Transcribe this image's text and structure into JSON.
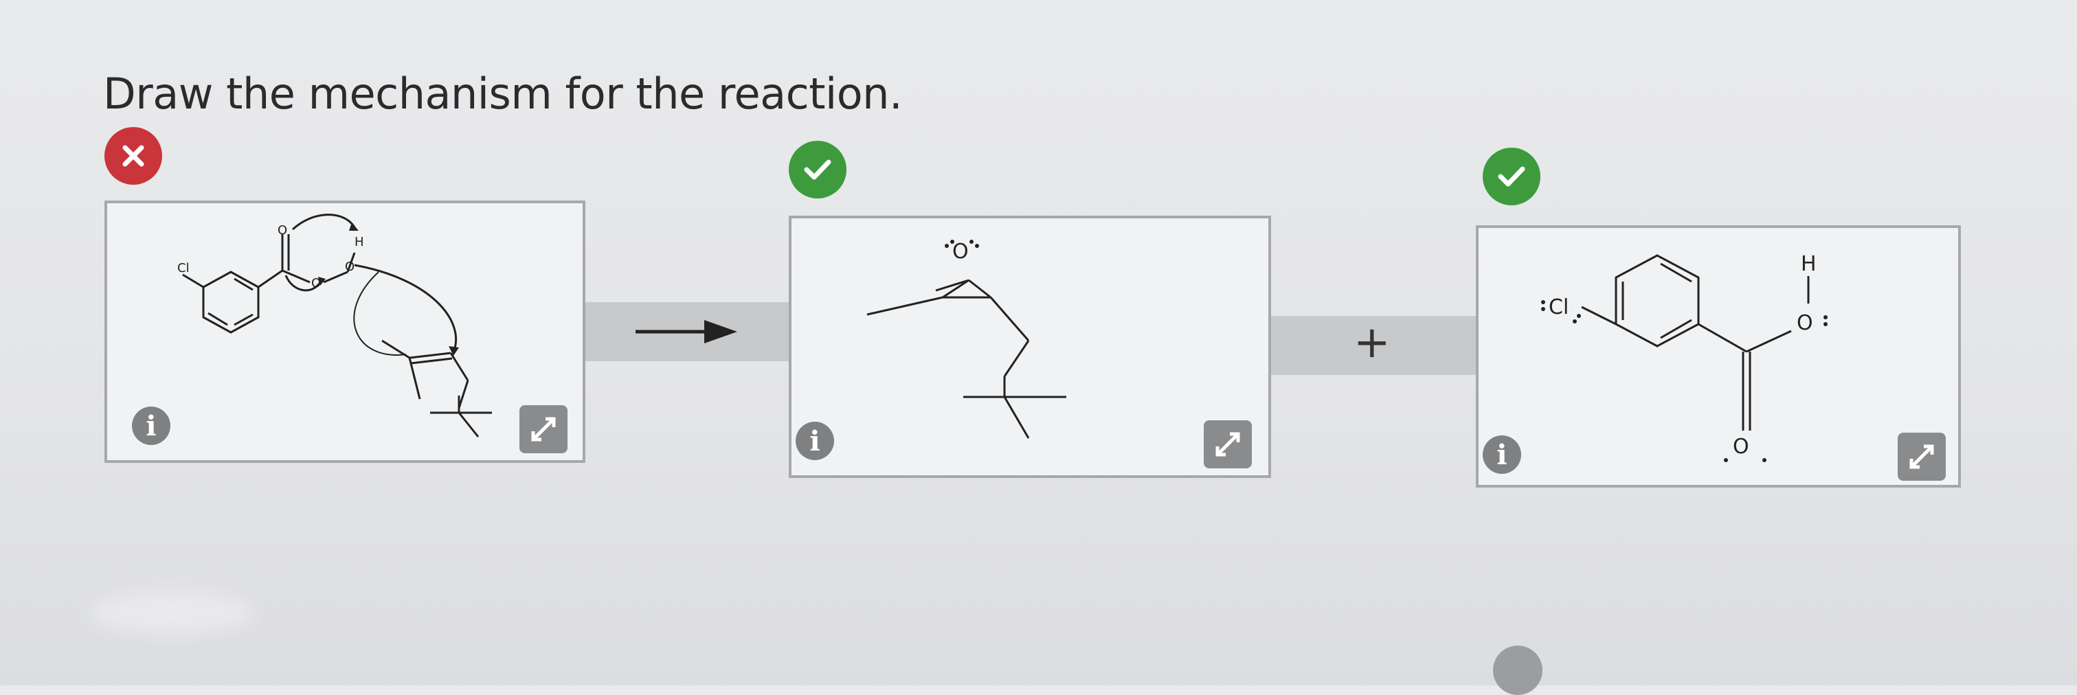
{
  "question": {
    "prompt": "Draw the mechanism for the reaction."
  },
  "status_icons": {
    "reactant": "error-x-icon",
    "product_1": "correct-check-icon",
    "product_2": "correct-check-icon"
  },
  "colors": {
    "error": "#c9353b",
    "correct": "#3d9b3d",
    "panel_border": "#a7a8aa",
    "button_gray": "#8a8b8c"
  },
  "operators": {
    "plus": "+"
  },
  "panels": [
    {
      "name": "reactants-mechanism",
      "info_label": "i",
      "atom_labels": {
        "cl": "Cl",
        "o1": "O",
        "o2": "O",
        "o3": "O",
        "h": "H"
      }
    },
    {
      "name": "epoxide-product",
      "info_label": "i",
      "atom_labels": {
        "o": "O"
      }
    },
    {
      "name": "acid-product",
      "info_label": "i",
      "atom_labels": {
        "cl": "Cl",
        "o_carbonyl": "O",
        "o_hydroxyl": "O",
        "h": "H"
      }
    }
  ]
}
